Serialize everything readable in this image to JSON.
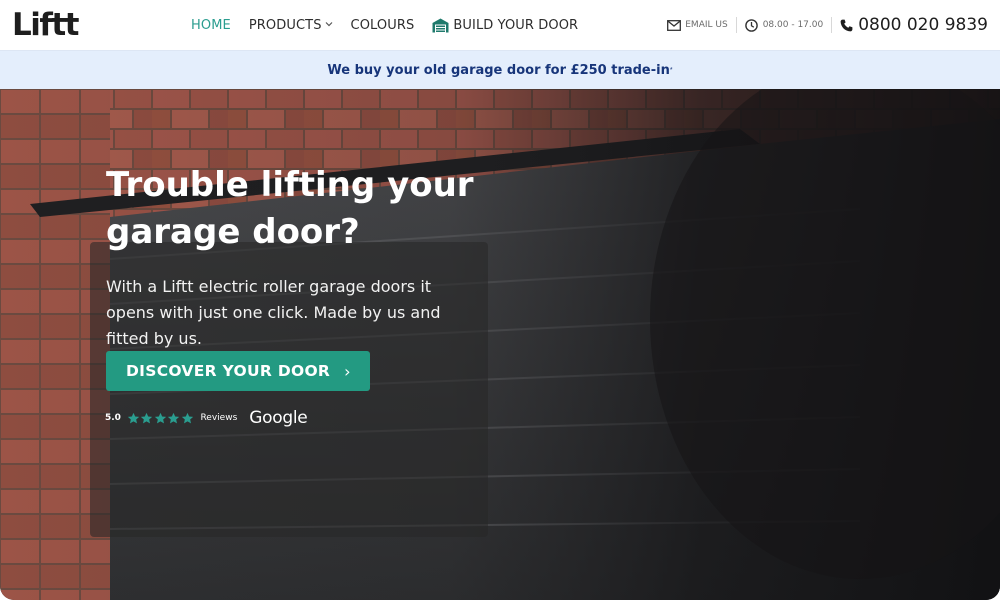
{
  "brand": {
    "logo_text": "Liftt"
  },
  "nav": {
    "items": [
      {
        "label": "HOME",
        "active": true
      },
      {
        "label": "PRODUCTS",
        "has_dropdown": true
      },
      {
        "label": "COLOURS"
      },
      {
        "label": "BUILD YOUR DOOR",
        "icon": "garage-icon"
      }
    ]
  },
  "contact": {
    "email_label": "EMAIL US",
    "hours": "08.00 - 17.00",
    "phone": "0800 020 9839"
  },
  "promo": {
    "text": "We buy your old garage door for £250 trade-in",
    "mark": "*"
  },
  "hero": {
    "title": "Trouble lifting your garage door?",
    "text": "With a Liftt electric roller garage doors it opens with just one click. Made by us and fitted by us.",
    "cta_label": "DISCOVER YOUR DOOR",
    "cta_arrow": "›",
    "rating": "5.0",
    "stars": 5,
    "reviews_label": "Reviews",
    "google_label": "Google"
  },
  "colors": {
    "accent": "#2a9d8f",
    "cta": "#239a82",
    "promo_bg": "#e4eefc",
    "promo_text": "#17357a",
    "star": "#2a9d8f"
  }
}
